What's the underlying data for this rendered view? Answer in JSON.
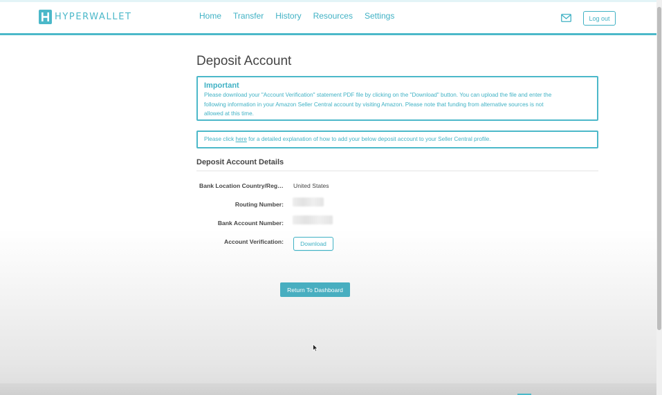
{
  "brand": {
    "name": "HYPERWALLET",
    "accent": "#4bb8c9"
  },
  "nav": {
    "items": [
      {
        "label": "Home"
      },
      {
        "label": "Transfer"
      },
      {
        "label": "History"
      },
      {
        "label": "Resources"
      },
      {
        "label": "Settings"
      }
    ],
    "mail_icon": "mail-icon",
    "logout_label": "Log out"
  },
  "page": {
    "title": "Deposit Account"
  },
  "notice": {
    "title": "Important",
    "line1": "Please download your \"Account Verification\" statement PDF file by clicking on the \"Download\" button. You can upload the file and enter the",
    "line2": "following information in your Amazon Seller Central account by visiting Amazon. Please note that funding from alternative sources is not",
    "line3": "allowed at this time."
  },
  "help": {
    "before": "Please click ",
    "link": "here",
    "after": " for a detailed explanation of how to add your below deposit account to your Seller Central profile."
  },
  "details": {
    "title": "Deposit Account Details",
    "fields": [
      {
        "label": "Bank Location Country/Region:",
        "value": "United States"
      },
      {
        "label": "Routing Number:",
        "value": ""
      },
      {
        "label": "Bank Account Number:",
        "value": ""
      },
      {
        "label": "Account Verification:",
        "value": ""
      }
    ],
    "download_label": "Download"
  },
  "actions": {
    "return_label": "Return To Dashboard"
  }
}
